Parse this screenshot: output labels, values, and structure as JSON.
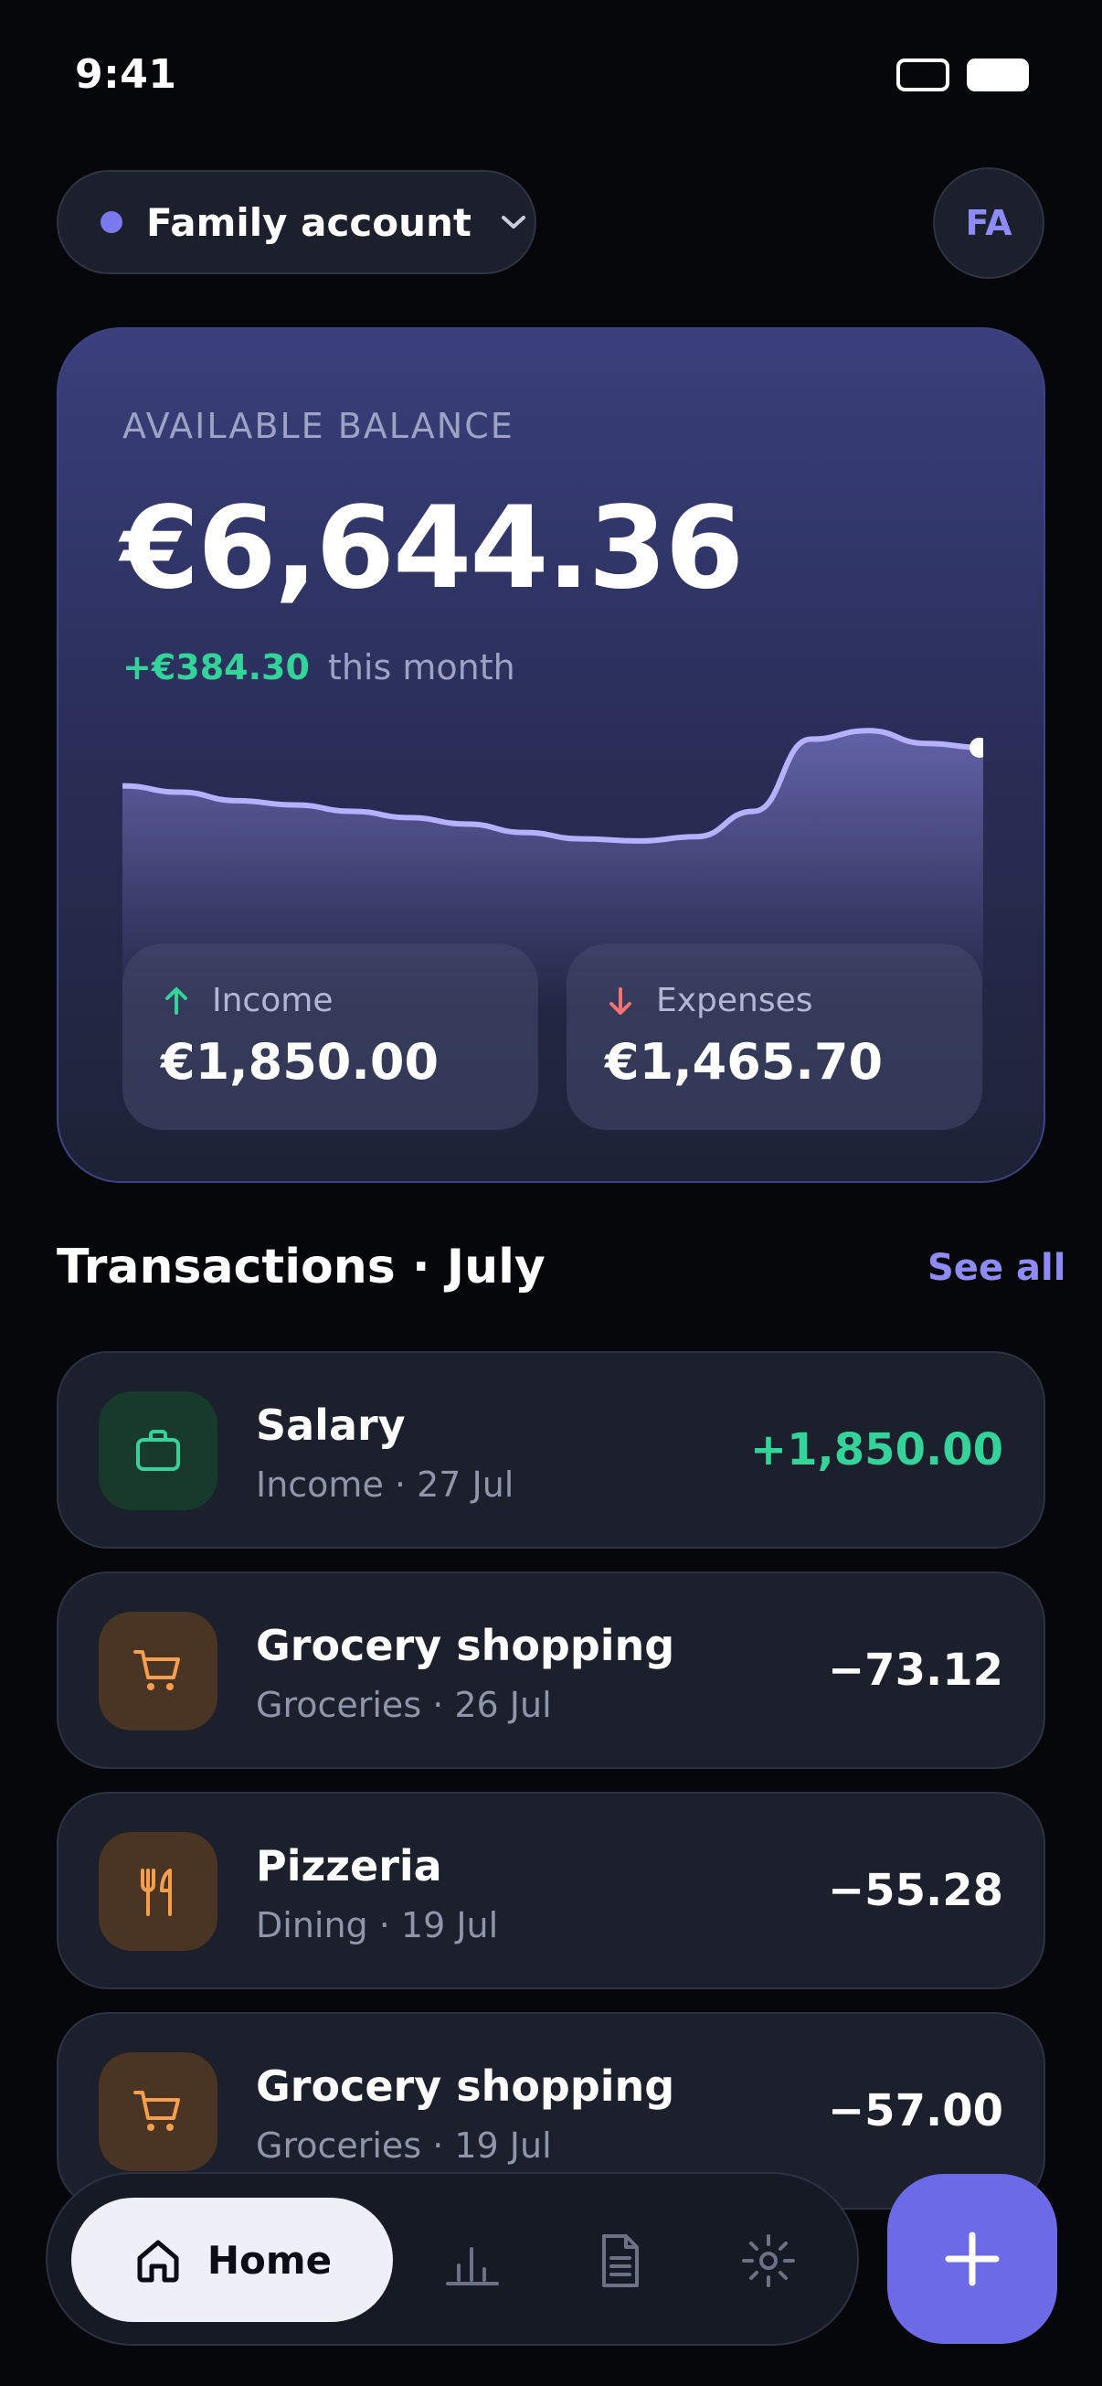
{
  "status_bar": {
    "time": "9:41"
  },
  "header": {
    "account_name": "Family account",
    "avatar_initials": "FA"
  },
  "balance": {
    "label": "AVAILABLE BALANCE",
    "amount": "€6,644.36",
    "change_amount": "+€384.30",
    "change_label": "this month",
    "trend": [
      0.7,
      0.67,
      0.63,
      0.61,
      0.58,
      0.55,
      0.52,
      0.48,
      0.45,
      0.44,
      0.46,
      0.58,
      0.92,
      0.96,
      0.9,
      0.88
    ],
    "income": {
      "label": "Income",
      "value": "€1,850.00"
    },
    "expenses": {
      "label": "Expenses",
      "value": "€1,465.70"
    }
  },
  "transactions": {
    "title": "Transactions · July",
    "see_all": "See all",
    "items": [
      {
        "title": "Salary",
        "subtitle": "Income · 27 Jul",
        "amount": "+1,850.00",
        "icon": "briefcase-icon"
      },
      {
        "title": "Grocery shopping",
        "subtitle": "Groceries · 26 Jul",
        "amount": "−73.12",
        "icon": "cart-icon"
      },
      {
        "title": "Pizzeria",
        "subtitle": "Dining · 19 Jul",
        "amount": "−55.28",
        "icon": "utensils-icon"
      },
      {
        "title": "Grocery shopping",
        "subtitle": "Groceries · 19 Jul",
        "amount": "−57.00",
        "icon": "cart-icon"
      }
    ]
  },
  "nav": {
    "home_label": "Home",
    "items": [
      "home-icon",
      "chart-icon",
      "document-icon",
      "settings-icon"
    ],
    "fab_icon": "plus-icon"
  },
  "colors": {
    "accent": "#6d6ae8",
    "positive": "#34d399",
    "negative": "#f87171",
    "background": "#06070b"
  }
}
